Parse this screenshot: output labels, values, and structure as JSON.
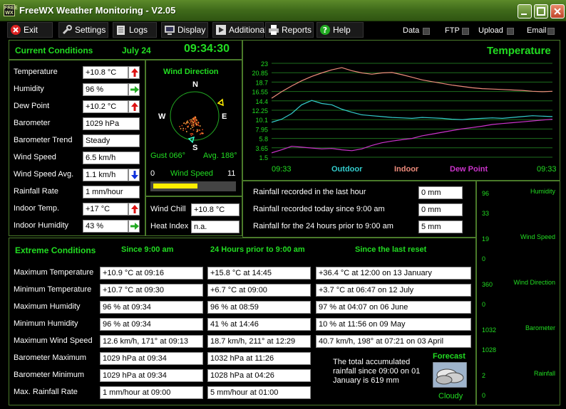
{
  "window": {
    "title": "FreeWX Weather Monitoring - V2.05",
    "icon_text": "FREE WX"
  },
  "menu": [
    {
      "label": "Exit",
      "icon": "close-icon"
    },
    {
      "label": "Settings",
      "icon": "wrench-icon"
    },
    {
      "label": "Logs",
      "icon": "logs-icon"
    },
    {
      "label": "Display",
      "icon": "monitor-icon"
    },
    {
      "label": "Additional",
      "icon": "play-icon"
    },
    {
      "label": "Reports",
      "icon": "printer-icon"
    },
    {
      "label": "Help",
      "icon": "help-icon"
    }
  ],
  "status_flags": [
    {
      "label": "Data"
    },
    {
      "label": "FTP"
    },
    {
      "label": "Upload"
    },
    {
      "label": "Email"
    }
  ],
  "current": {
    "title": "Current Conditions",
    "date": "July  24",
    "time": "09:34:30",
    "rows": [
      {
        "label": "Temperature",
        "value": "+10.8 °C",
        "arrow": "up"
      },
      {
        "label": "Humidity",
        "value": "96 %",
        "arrow": "right"
      },
      {
        "label": "Dew Point",
        "value": "+10.2 °C",
        "arrow": "up"
      },
      {
        "label": "Barometer",
        "value": "1029 hPa"
      },
      {
        "label": "Barometer Trend",
        "value": "Steady"
      },
      {
        "label": "Wind Speed",
        "value": "6.5 km/h"
      },
      {
        "label": "Wind Speed Avg.",
        "value": "1.1 km/h",
        "arrow": "down"
      },
      {
        "label": "Rainfall Rate",
        "value": "1 mm/hour"
      },
      {
        "label": "Indoor Temp.",
        "value": "+17 °C",
        "arrow": "up"
      },
      {
        "label": "Indoor Humidity",
        "value": "43 %",
        "arrow": "right"
      }
    ]
  },
  "wind": {
    "title": "Wind Direction",
    "compass": {
      "n": "N",
      "s": "S",
      "e": "E",
      "w": "W"
    },
    "gust": "Gust 066°",
    "avg": "Avg. 188°",
    "scale_min": "0",
    "scale_label": "Wind Speed",
    "scale_max": "11",
    "speed_bar_fraction": 0.55,
    "wind_chill_label": "Wind Chill",
    "wind_chill_value": "+10.8 °C",
    "heat_index_label": "Heat Index",
    "heat_index_value": "n.a."
  },
  "temperature_chart": {
    "title": "Temperature",
    "chart_data": {
      "type": "line",
      "y_ticks": [
        "23",
        "20.85",
        "18.7",
        "16.55",
        "14.4",
        "12.25",
        "10.1",
        "7.95",
        "5.8",
        "3.65",
        "1.5"
      ],
      "ylim": [
        1.5,
        23
      ],
      "x_start": "09:33",
      "x_end": "09:33",
      "series": [
        {
          "name": "Outdoor",
          "color": "#33cccc",
          "values": [
            9.5,
            10.2,
            11.5,
            13.5,
            14.5,
            13.8,
            13.5,
            12.5,
            11.8,
            11.2,
            11.0,
            10.8,
            10.6,
            10.5,
            10.4,
            10.6,
            10.5,
            10.4,
            10.2,
            10.1,
            10.3,
            10.4,
            10.5,
            10.4,
            10.6,
            10.8,
            11.0,
            10.9,
            10.8
          ]
        },
        {
          "name": "Indoor",
          "color": "#ee8c7c",
          "values": [
            15.0,
            16.5,
            17.8,
            19.0,
            20.0,
            20.8,
            21.5,
            22.0,
            21.3,
            20.8,
            20.5,
            20.8,
            20.9,
            20.4,
            19.8,
            19.2,
            18.8,
            18.4,
            18.0,
            17.7,
            17.4,
            17.2,
            17.1,
            17.0,
            16.9,
            16.8,
            16.6,
            16.5,
            16.6
          ]
        },
        {
          "name": "Dew Point",
          "color": "#cc33cc",
          "values": [
            2.5,
            3.2,
            4.0,
            3.8,
            3.6,
            3.4,
            3.5,
            3.2,
            3.0,
            3.4,
            4.2,
            4.8,
            5.2,
            5.5,
            5.8,
            6.4,
            6.8,
            7.2,
            7.6,
            8.0,
            8.3,
            8.6,
            9.0,
            9.2,
            9.4,
            9.6,
            9.8,
            10.0,
            10.2
          ]
        }
      ]
    }
  },
  "rainfall": {
    "last_hour_label": "Rainfall recorded in the last hour",
    "last_hour_value": "0 mm",
    "today_label": "Rainfall recorded today since 9:00 am",
    "today_value": "0 mm",
    "prior_label": "Rainfall for the 24 hours prior to 9:00 am",
    "prior_value": "5 mm"
  },
  "extremes": {
    "title": "Extreme Conditions",
    "col1": "Since 9:00 am",
    "col2": "24 Hours prior to 9:00 am",
    "col3": "Since the last reset",
    "rows": [
      {
        "label": "Maximum Temperature",
        "c1": "+10.9 °C at 09:16",
        "c2": "+15.8 °C at 14:45",
        "c3": "+36.4 °C at 12:00 on 13 January"
      },
      {
        "label": "Minimum Temperature",
        "c1": "+10.7 °C at 09:30",
        "c2": "+6.7 °C at 09:00",
        "c3": "+3.7 °C at 06:47 on 12 July"
      },
      {
        "label": "Maximum Humidity",
        "c1": "96 % at 09:34",
        "c2": "96 % at 08:59",
        "c3": "97 % at 04:07 on 06 June"
      },
      {
        "label": "Minimum Humidity",
        "c1": "96 % at 09:34",
        "c2": "41 % at 14:46",
        "c3": "10 % at 11:56 on 09 May"
      },
      {
        "label": "Maximum Wind Speed",
        "c1": "12.6 km/h, 171° at 09:13",
        "c2": "18.7 km/h, 211° at 12:29",
        "c3": "40.7 km/h, 198° at 07:21 on 03 April"
      },
      {
        "label": "Barometer Maximum",
        "c1": "1029 hPa at 09:34",
        "c2": "1032 hPa at 11:26"
      },
      {
        "label": "Barometer Minimum",
        "c1": "1029 hPa at 09:34",
        "c2": "1028 hPa at 04:26"
      },
      {
        "label": "Max. Rainfall Rate",
        "c1": "1 mm/hour at 09:00",
        "c2": "5 mm/hour at 01:00"
      }
    ],
    "total_text": "The total accumulated rainfall since 09:00 on 01 January is 619 mm"
  },
  "forecast": {
    "title": "Forecast",
    "value": "Cloudy"
  },
  "mini_charts": [
    {
      "title": "Humidity",
      "ymax": "96",
      "ymin": "33"
    },
    {
      "title": "Wind Speed",
      "ymax": "19",
      "ymin": "0"
    },
    {
      "title": "Wind Direction",
      "ymax": "360",
      "ymin": "0"
    },
    {
      "title": "Barometer",
      "ymax": "1032",
      "ymin": "1028"
    },
    {
      "title": "Rainfall",
      "ymax": "2",
      "ymin": "0"
    }
  ]
}
